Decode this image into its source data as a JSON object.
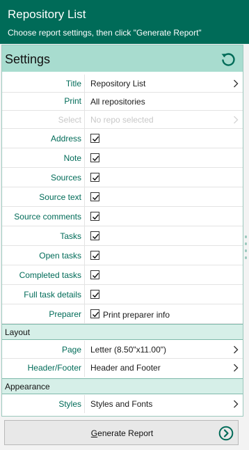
{
  "header": {
    "title": "Repository List",
    "subtitle": "Choose report settings, then click \"Generate Report\""
  },
  "settings": {
    "heading": "Settings",
    "reset_icon": "reset-icon",
    "rows": {
      "title": {
        "label": "Title",
        "value": "Repository List"
      },
      "print": {
        "label": "Print",
        "value": "All repositories"
      },
      "select": {
        "label": "Select",
        "value": "No repo selected"
      },
      "address": {
        "label": "Address",
        "checked": true
      },
      "note": {
        "label": "Note",
        "checked": true
      },
      "sources": {
        "label": "Sources",
        "checked": true
      },
      "source_text": {
        "label": "Source text",
        "checked": true
      },
      "source_comments": {
        "label": "Source comments",
        "checked": true
      },
      "tasks": {
        "label": "Tasks",
        "checked": true
      },
      "open_tasks": {
        "label": "Open tasks",
        "checked": true
      },
      "completed_tasks": {
        "label": "Completed tasks",
        "checked": true
      },
      "full_task_details": {
        "label": "Full task details",
        "checked": true
      },
      "preparer": {
        "label": "Preparer",
        "checked": true,
        "checkbox_label": "Print preparer info"
      }
    }
  },
  "layout": {
    "heading": "Layout",
    "page": {
      "label": "Page",
      "value": "Letter (8.50\"x11.00\")"
    },
    "header_footer": {
      "label": "Header/Footer",
      "value": "Header and Footer"
    }
  },
  "appearance": {
    "heading": "Appearance",
    "styles": {
      "label": "Styles",
      "value": "Styles and Fonts"
    }
  },
  "footer": {
    "generate_first": "G",
    "generate_rest": "enerate Report",
    "generate_icon": "circle-arrow-right-icon"
  },
  "colors": {
    "brand": "#006b58",
    "settings_bar": "#a8dccf",
    "section_bar": "#d6efe8"
  }
}
